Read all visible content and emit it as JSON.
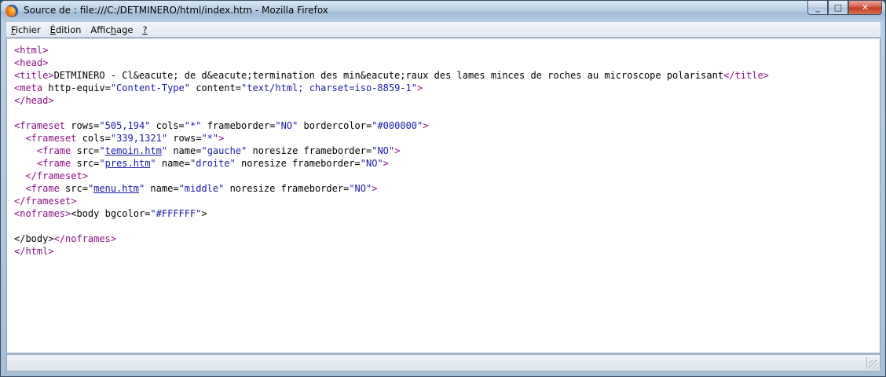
{
  "window": {
    "title": "Source de : file:///C:/DETMINERO/html/index.htm - Mozilla Firefox",
    "icon": "firefox-icon",
    "controls": {
      "minimize": "_",
      "maximize": "□",
      "close": "✕"
    }
  },
  "menu": [
    {
      "pre": "",
      "u": "F",
      "post": "ichier"
    },
    {
      "pre": "",
      "u": "É",
      "post": "dition"
    },
    {
      "pre": "Affic",
      "u": "h",
      "post": "age"
    },
    {
      "pre": "",
      "u": "?",
      "post": ""
    }
  ],
  "source": {
    "lines": [
      [
        [
          "t",
          "<html>"
        ]
      ],
      [
        [
          "t",
          "<head>"
        ]
      ],
      [
        [
          "t",
          "<title>"
        ],
        [
          "x",
          "DETMINERO - Cl&eacute; de d&eacute;termination des min&eacute;raux des lames minces de roches au microscope polarisant"
        ],
        [
          "t",
          "</title>"
        ]
      ],
      [
        [
          "t",
          "<meta"
        ],
        [
          "x",
          " http-equiv="
        ],
        [
          "v",
          "\"Content-Type\""
        ],
        [
          "x",
          " content="
        ],
        [
          "v",
          "\"text/html; charset=iso-8859-1\""
        ],
        [
          "t",
          ">"
        ]
      ],
      [
        [
          "t",
          "</head>"
        ]
      ],
      [],
      [
        [
          "t",
          "<frameset"
        ],
        [
          "x",
          " rows="
        ],
        [
          "v",
          "\"505,194\""
        ],
        [
          "x",
          " cols="
        ],
        [
          "v",
          "\"*\""
        ],
        [
          "x",
          " frameborder="
        ],
        [
          "v",
          "\"NO\""
        ],
        [
          "x",
          " bordercolor="
        ],
        [
          "v",
          "\"#000000\""
        ],
        [
          "t",
          ">"
        ]
      ],
      [
        [
          "x",
          "  "
        ],
        [
          "t",
          "<frameset"
        ],
        [
          "x",
          " cols="
        ],
        [
          "v",
          "\"339,1321\""
        ],
        [
          "x",
          " rows="
        ],
        [
          "v",
          "\"*\""
        ],
        [
          "t",
          ">"
        ]
      ],
      [
        [
          "x",
          "    "
        ],
        [
          "t",
          "<frame"
        ],
        [
          "x",
          " src="
        ],
        [
          "v",
          "\""
        ],
        [
          "l",
          "temoin.htm"
        ],
        [
          "v",
          "\""
        ],
        [
          "x",
          " name="
        ],
        [
          "v",
          "\"gauche\""
        ],
        [
          "x",
          " noresize frameborder="
        ],
        [
          "v",
          "\"NO\""
        ],
        [
          "t",
          ">"
        ]
      ],
      [
        [
          "x",
          "    "
        ],
        [
          "t",
          "<frame"
        ],
        [
          "x",
          " src="
        ],
        [
          "v",
          "\""
        ],
        [
          "l",
          "pres.htm"
        ],
        [
          "v",
          "\""
        ],
        [
          "x",
          " name="
        ],
        [
          "v",
          "\"droite\""
        ],
        [
          "x",
          " noresize frameborder="
        ],
        [
          "v",
          "\"NO\""
        ],
        [
          "t",
          ">"
        ]
      ],
      [
        [
          "x",
          "  "
        ],
        [
          "t",
          "</frameset>"
        ]
      ],
      [
        [
          "x",
          "  "
        ],
        [
          "t",
          "<frame"
        ],
        [
          "x",
          " src="
        ],
        [
          "v",
          "\""
        ],
        [
          "l",
          "menu.htm"
        ],
        [
          "v",
          "\""
        ],
        [
          "x",
          " name="
        ],
        [
          "v",
          "\"middle\""
        ],
        [
          "x",
          " noresize frameborder="
        ],
        [
          "v",
          "\"NO\""
        ],
        [
          "t",
          ">"
        ]
      ],
      [
        [
          "t",
          "</frameset>"
        ]
      ],
      [
        [
          "t",
          "<noframes>"
        ],
        [
          "x",
          "<body bgcolor="
        ],
        [
          "v",
          "\"#FFFFFF\""
        ],
        [
          "x",
          ">"
        ]
      ],
      [],
      [
        [
          "x",
          "</body>"
        ],
        [
          "t",
          "</noframes>"
        ]
      ],
      [
        [
          "t",
          "</html>"
        ]
      ]
    ]
  },
  "status": {
    "text": ""
  },
  "colors": {
    "tag": "#881280",
    "value": "#1a1aa6",
    "text": "#000000"
  }
}
